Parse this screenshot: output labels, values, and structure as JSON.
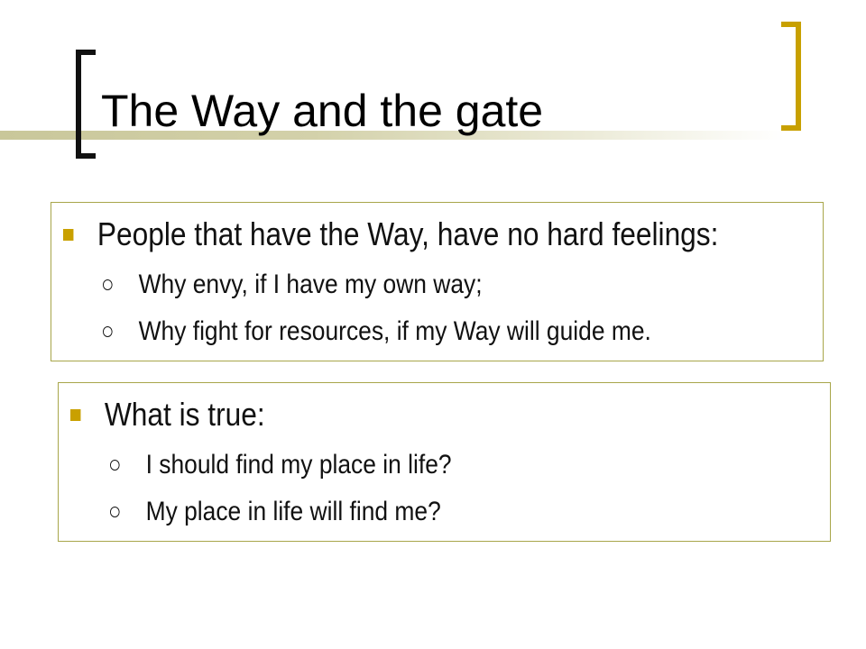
{
  "slide": {
    "title": "The Way and the gate",
    "colors": {
      "accent_bracket": "#c8a000",
      "bullet_square": "#c9a000",
      "box_border": "#a8a64a",
      "title_rule": "#c9c79a"
    },
    "boxes": [
      {
        "heading": "People that have the Way, have no hard feelings:",
        "items": [
          "Why envy, if I have my own way;",
          "Why fight for resources, if my Way will guide me."
        ]
      },
      {
        "heading": "What is true:",
        "items": [
          "I should find my place in life?",
          "My place in life will find me?"
        ]
      }
    ]
  }
}
